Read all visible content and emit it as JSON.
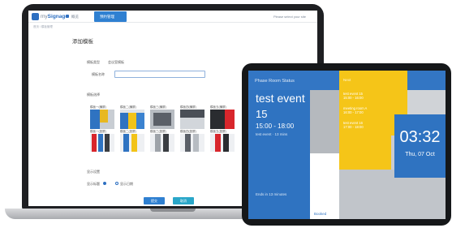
{
  "laptop": {
    "topbar": {
      "brand": "Signage",
      "brand_prefix": "my",
      "nav_item_1": "概览",
      "nav_active": "预约管理",
      "right_text": "Please select your site"
    },
    "breadcrumb": "首页 / 模板管理",
    "panel": {
      "title": "添加模板",
      "field_type_label": "模板类型",
      "field_type_value": "会议室模板",
      "field_name_label": "模板名称",
      "field_name_value": "",
      "templates_label": "模板选择",
      "templates_row1": [
        "模板一(横屏)",
        "模板二(横屏)",
        "模板三(横屏)",
        "模板四(横屏)",
        "模板五(横屏)"
      ],
      "templates_row2": [
        "模板一(竖屏)",
        "模板二(竖屏)",
        "模板三(竖屏)",
        "模板四(竖屏)",
        "模板五(竖屏)"
      ],
      "display_label": "显示设置",
      "radio_1": "显示标题",
      "radio_2": "显示日期",
      "submit_label": "提交",
      "cancel_label": "取消"
    }
  },
  "tablet": {
    "header_title": "Phase Room Status",
    "yellow_head": "Next",
    "event": {
      "title": "test event",
      "day": "15",
      "time": "15:00 - 18:00",
      "organizer": "test event · 13 mins",
      "footer": "Ends in 13 minutes"
    },
    "white_label": "Booked",
    "upcoming": [
      {
        "line1": "test event 15",
        "line2": "15:00 - 16:00"
      },
      {
        "line1": "meeting room A",
        "line2": "16:00 - 17:00"
      },
      {
        "line1": "test event 16",
        "line2": "17:00 - 18:00"
      }
    ],
    "clock_time": "03:32",
    "clock_date": "Thu, 07 Oct"
  },
  "colors": {
    "primary_blue": "#2f73c1",
    "accent_yellow": "#f5c518",
    "teal_button": "#2aa7c9"
  }
}
